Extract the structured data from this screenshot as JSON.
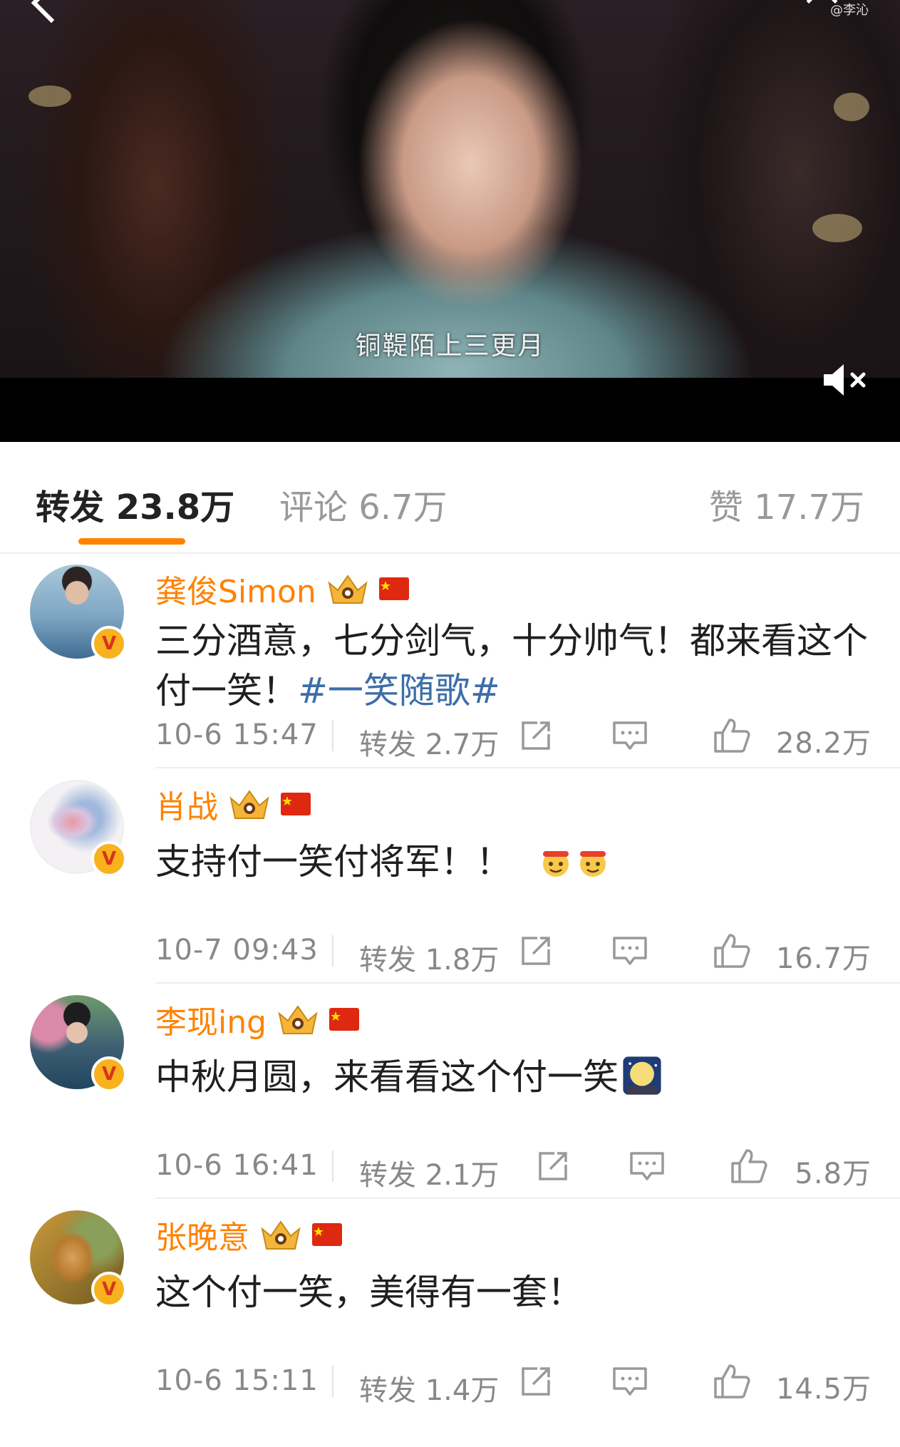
{
  "video": {
    "subtitle": "铜鞮陌上三更月",
    "watermark": "@李沁"
  },
  "tabs": {
    "repost": "转发 23.8万",
    "comment": "评论 6.7万",
    "like": "赞 17.7万"
  },
  "reposts": [
    {
      "name": "龚俊Simon",
      "text": "三分酒意，七分剑气，十分帅气！都来看这个付一笑！",
      "topic": "#一笑随歌#",
      "time": "10-6 15:47",
      "repost": "转发 2.7万",
      "likes": "28.2万"
    },
    {
      "name": "肖战",
      "text": "支持付一笑付将军！！",
      "topic": "",
      "time": "10-7 09:43",
      "repost": "转发 1.8万",
      "likes": "16.7万"
    },
    {
      "name": "李现ing",
      "text": "中秋月圆，来看看这个付一笑",
      "topic": "",
      "time": "10-6 16:41",
      "repost": "转发 2.1万",
      "likes": "5.8万"
    },
    {
      "name": "张晚意",
      "text": "这个付一笑，美得有一套！",
      "topic": "",
      "time": "10-6 15:11",
      "repost": "转发 1.4万",
      "likes": "14.5万"
    }
  ],
  "colors": {
    "accent": "#ff8200",
    "topic": "#3d6ea8"
  }
}
